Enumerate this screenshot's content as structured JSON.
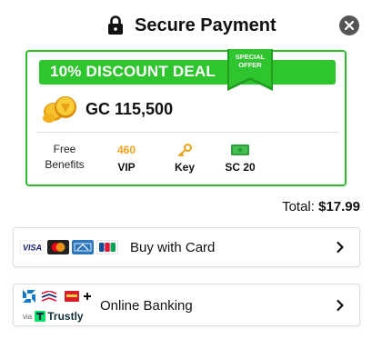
{
  "header": {
    "title": "Secure Payment",
    "lock_icon": "lock-icon",
    "close_icon": "close-icon"
  },
  "deal": {
    "banner_text": "10% DISCOUNT DEAL",
    "ribbon_line1": "SPECIAL",
    "ribbon_line2": "OFFER",
    "coin_icon": "gold-coins-icon",
    "gc_amount": "GC 115,500",
    "benefits_title_line1": "Free",
    "benefits_title_line2": "Benefits",
    "benefits": [
      {
        "top": "460",
        "label": "VIP",
        "icon": "vip-points"
      },
      {
        "top": "",
        "label": "Key",
        "icon": "key-icon"
      },
      {
        "top": "",
        "label": "SC 20",
        "icon": "cash-icon"
      }
    ],
    "colors": {
      "accent": "#2ec52e",
      "border": "#2fbb2f",
      "gold": "#f5a11a"
    }
  },
  "total": {
    "label": "Total:",
    "amount": "$17.99"
  },
  "payment_options": [
    {
      "label": "Buy with Card",
      "logos": [
        "VISA",
        "mastercard",
        "AMEX",
        "JCB"
      ]
    },
    {
      "label": "Online Banking",
      "via": "via",
      "provider": "Trustly"
    }
  ]
}
